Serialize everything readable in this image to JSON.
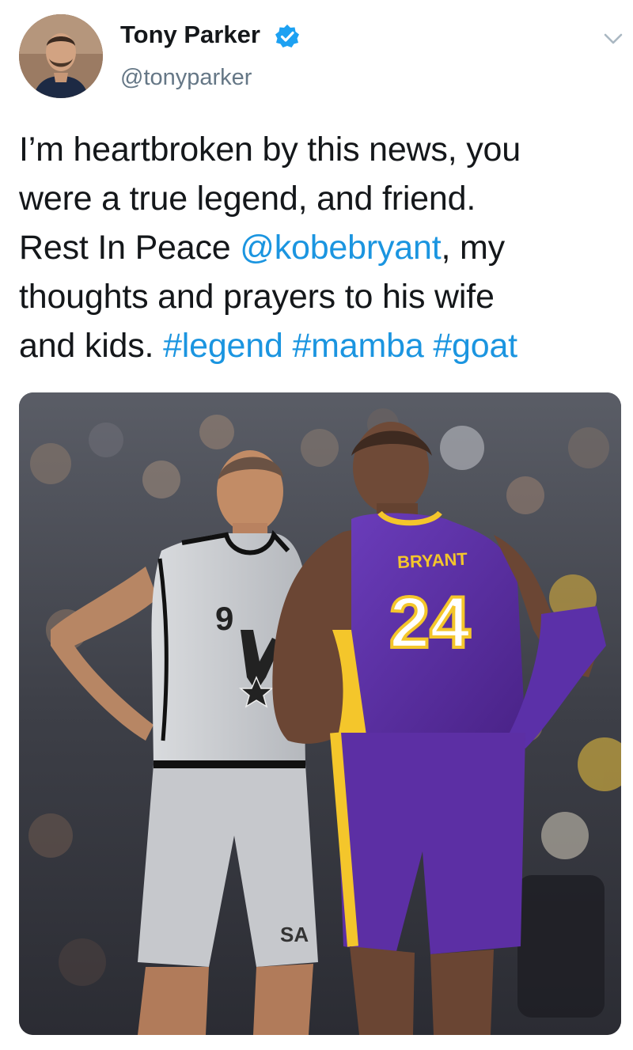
{
  "author": {
    "display_name": "Tony Parker",
    "handle": "@tonyparker",
    "avatar_icon": "user-avatar",
    "verified_icon": "verified-badge-icon",
    "verified_color": "#1da1f2"
  },
  "menu": {
    "icon": "chevron-down-icon"
  },
  "tweet": {
    "lines": [
      [
        "I’m heartbroken by this news, you"
      ],
      [
        "were a true legend, and friend."
      ],
      [
        "Rest In Peace ",
        "@kobebryant",
        ", my"
      ],
      [
        "thoughts and prayers to his wife"
      ],
      [
        "and kids. ",
        "#legend",
        " ",
        "#mamba",
        " ",
        "#goat"
      ]
    ],
    "mention": "@kobebryant",
    "hashtags": [
      "#legend",
      "#mamba",
      "#goat"
    ],
    "link_color": "#1b95e0"
  },
  "media": {
    "icon": "photo",
    "left_jersey_number": "9",
    "right_jersey_name": "BRYANT",
    "right_jersey_number": "24",
    "shorts_logo": "SA",
    "colors": {
      "spurs_silver": "#c9cbcf",
      "lakers_purple": "#5a2fa3",
      "lakers_gold": "#f4c62b"
    }
  }
}
